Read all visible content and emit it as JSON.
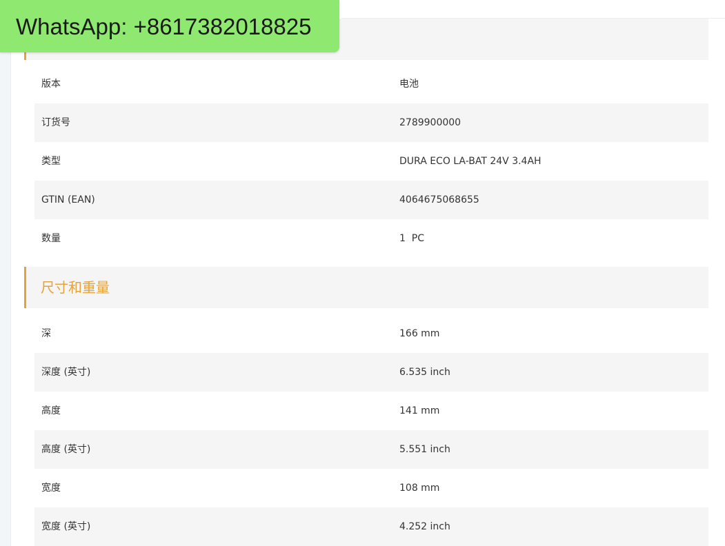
{
  "watermark": {
    "text": "WhatsApp: +8617382018825",
    "background_color": "#8fe870"
  },
  "colors": {
    "accent": "#e3a33c",
    "row_shade": "#f5f5f5",
    "text": "#333333"
  },
  "general_rows": [
    {
      "label": "版本",
      "value": "电池"
    },
    {
      "label": "订货号",
      "value": "2789900000"
    },
    {
      "label": "类型",
      "value": "DURA ECO LA-BAT 24V 3.4AH"
    },
    {
      "label": "GTIN (EAN)",
      "value": "4064675068655"
    },
    {
      "label": "数量",
      "value": "1  PC"
    }
  ],
  "dimensions_section": {
    "title": "尺寸和重量",
    "rows": [
      {
        "label": "深",
        "value": "166 mm"
      },
      {
        "label": "深度 (英寸)",
        "value": "6.535 inch"
      },
      {
        "label": "高度",
        "value": "141 mm"
      },
      {
        "label": "高度 (英寸)",
        "value": "5.551 inch"
      },
      {
        "label": "宽度",
        "value": "108 mm"
      },
      {
        "label": "宽度 (英寸)",
        "value": "4.252 inch"
      }
    ]
  }
}
